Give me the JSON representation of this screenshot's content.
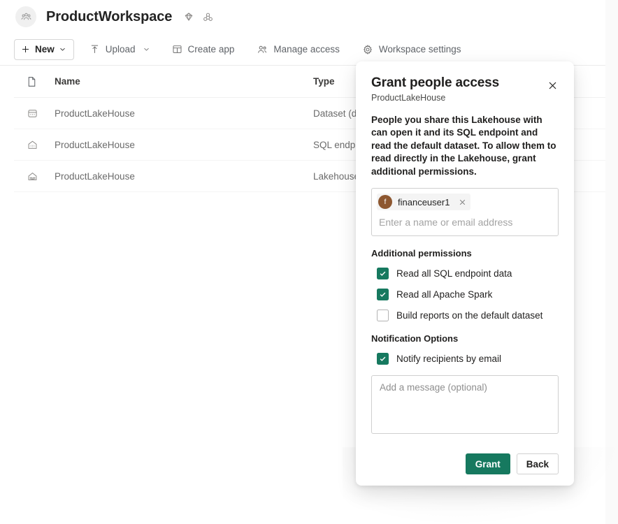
{
  "workspace": {
    "avatar_icon": "people-group-icon",
    "title": "ProductWorkspace",
    "badges": [
      {
        "icon": "diamond-premium-icon",
        "name": "premium-capacity-badge"
      },
      {
        "icon": "fabric-trial-icon",
        "name": "fabric-trial-badge"
      }
    ]
  },
  "commandbar": {
    "new_label": "New",
    "new_icon": "plus-icon",
    "new_chevron": "chevron-down-icon",
    "items": [
      {
        "label": "Upload",
        "icon": "upload-arrow-icon",
        "has_chevron": true
      },
      {
        "label": "Create app",
        "icon": "app-grid-icon",
        "has_chevron": false
      },
      {
        "label": "Manage access",
        "icon": "people-icon",
        "has_chevron": false
      },
      {
        "label": "Workspace settings",
        "icon": "gear-icon",
        "has_chevron": false
      }
    ]
  },
  "table": {
    "columns": {
      "icon_header": "document-icon",
      "name": "Name",
      "type": "Type"
    },
    "rows": [
      {
        "icon": "dataset-icon",
        "name": "ProductLakeHouse",
        "type": "Dataset (d"
      },
      {
        "icon": "sql-endpoint-icon",
        "name": "ProductLakeHouse",
        "type": "SQL endp"
      },
      {
        "icon": "lakehouse-icon",
        "name": "ProductLakeHouse",
        "type": "Lakehouse"
      }
    ]
  },
  "panel": {
    "title": "Grant people access",
    "subtitle": "ProductLakeHouse",
    "close_icon": "close-icon",
    "description": "People you share this Lakehouse with can open it and its SQL endpoint and read the default dataset. To allow them to read directly in the Lakehouse, grant additional permissions.",
    "people_picker": {
      "placeholder": "Enter a name or email address",
      "value": "",
      "tokens": [
        {
          "initial": "f",
          "label": "financeuser1",
          "avatar_color": "#8d5730",
          "remove_icon": "close-icon"
        }
      ]
    },
    "additional_permissions": {
      "title": "Additional permissions",
      "options": [
        {
          "label": "Read all SQL endpoint data",
          "checked": true
        },
        {
          "label": "Read all Apache Spark",
          "checked": true
        },
        {
          "label": "Build reports on the default dataset",
          "checked": false
        }
      ]
    },
    "notification_options": {
      "title": "Notification Options",
      "options": [
        {
          "label": "Notify recipients by email",
          "checked": true
        }
      ]
    },
    "message": {
      "placeholder": "Add a message (optional)",
      "value": ""
    },
    "footer": {
      "primary_label": "Grant",
      "secondary_label": "Back"
    }
  },
  "colors": {
    "accent_green": "#16795f",
    "avatar_brown": "#8d5730",
    "page_background": "#fafafa",
    "surface": "#ffffff",
    "text_primary": "#201f1e",
    "text_secondary": "#6b6b6b"
  }
}
